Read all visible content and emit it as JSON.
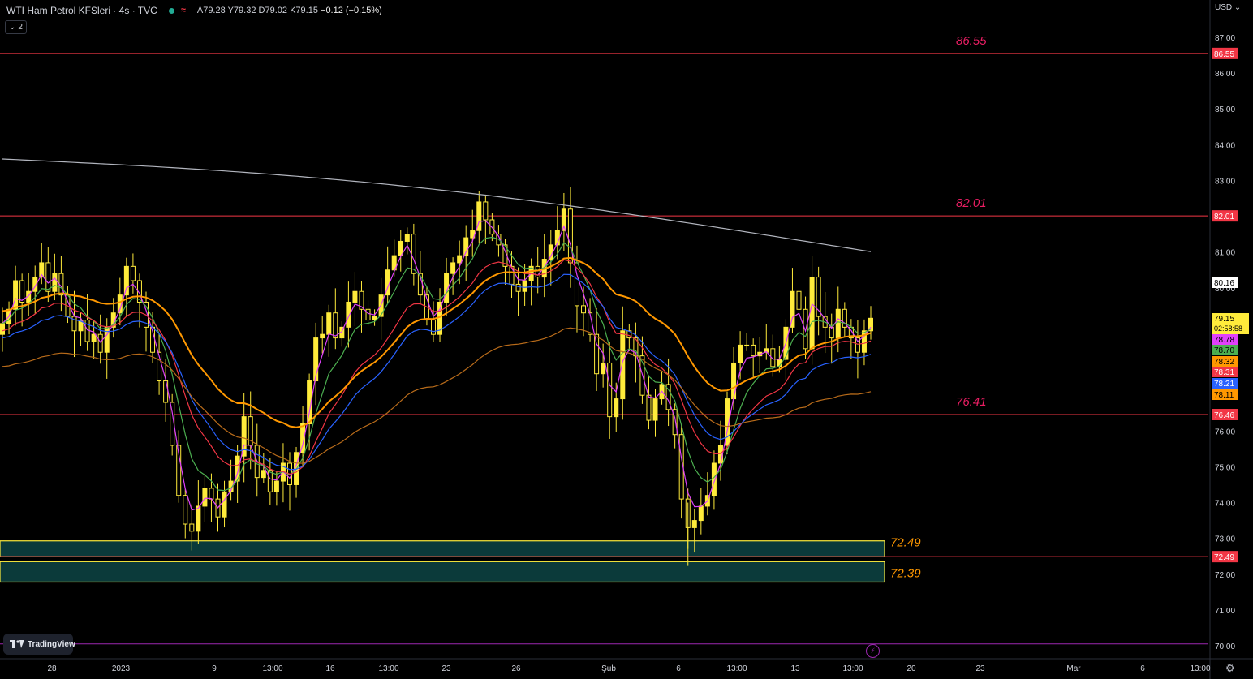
{
  "header": {
    "title": "WTI Ham Petrol KFSleri · 4s · TVC",
    "status_icon": "market-open-dot",
    "o": "A79.28",
    "h": "Y79.32",
    "l": "D79.02",
    "c": "K79.15",
    "change": "−0.12 (−0.15%)",
    "collapse_count": "2"
  },
  "currency_label": "USD",
  "tradingview_label": "TradingView",
  "colors": {
    "background": "#000000",
    "candle": "#ffeb3b",
    "level_line": "#f23645",
    "level_label": "#e91e63",
    "zone_fill": "#0b3a3a",
    "zone_border": "#ffeb3b",
    "zone_label": "#ff9800",
    "purple_line": "#9c27b0",
    "ema_magenta": "#e040fb",
    "ema_green": "#4caf50",
    "ema_red": "#f23645",
    "ema_blue": "#2962ff",
    "ema_orange": "#ff9800",
    "ema_darkorange": "#b86b1a",
    "ema_white": "#b2b5be"
  },
  "chart_data": {
    "type": "candlestick",
    "title": "WTI Ham Petrol KFSleri · 4s · TVC",
    "y_range": [
      69.5,
      87.7
    ],
    "y_ticks": [
      "87.00",
      "86.00",
      "85.00",
      "84.00",
      "83.00",
      "82.00",
      "81.00",
      "80.00",
      "79.00",
      "78.00",
      "77.00",
      "76.00",
      "75.00",
      "74.00",
      "73.00",
      "72.00",
      "71.00",
      "70.00"
    ],
    "x_ticks": [
      "28",
      "2023",
      "9",
      "13:00",
      "16",
      "13:00",
      "23",
      "26",
      "Şub",
      "6",
      "13:00",
      "13",
      "13:00",
      "20",
      "23",
      "Mar",
      "6",
      "13:00"
    ],
    "levels": [
      {
        "value": 86.55,
        "label": "86.55",
        "axis_label": "86.55",
        "color": "#f23645"
      },
      {
        "value": 82.01,
        "label": "82.01",
        "axis_label": "82.01",
        "color": "#f23645"
      },
      {
        "value": 76.46,
        "label": "76.41",
        "axis_label": "76.46",
        "color": "#f23645"
      },
      {
        "value": 72.49,
        "axis_label": "72.49",
        "color": "#f23645"
      },
      {
        "value": 70.05,
        "color": "#9c27b0"
      }
    ],
    "zones": [
      {
        "from": 72.49,
        "to": 72.93,
        "label": "72.49"
      },
      {
        "from": 71.78,
        "to": 72.35,
        "label": "72.39"
      }
    ],
    "price_badges": [
      {
        "value": "80.16",
        "bg": "#ffffff",
        "fg": "#000000"
      },
      {
        "value": "79.15",
        "sub": "02:58:58",
        "bg": "#ffeb3b",
        "fg": "#000000"
      },
      {
        "value": "78.78",
        "bg": "#e040fb",
        "fg": "#000000"
      },
      {
        "value": "78.70",
        "bg": "#4caf50",
        "fg": "#000000"
      },
      {
        "value": "78.32",
        "bg": "#ff9800",
        "fg": "#000000"
      },
      {
        "value": "78.31",
        "bg": "#f23645",
        "fg": "#ffffff"
      },
      {
        "value": "78.21",
        "bg": "#2962ff",
        "fg": "#ffffff"
      },
      {
        "value": "78.11",
        "bg": "#ff9800",
        "fg": "#000000"
      }
    ],
    "closes": [
      79.0,
      79.4,
      80.2,
      79.6,
      79.9,
      80.3,
      80.7,
      79.9,
      80.4,
      79.8,
      79.2,
      78.8,
      79.1,
      78.5,
      78.7,
      78.2,
      78.9,
      79.3,
      79.8,
      80.6,
      80.2,
      79.6,
      78.9,
      78.2,
      77.4,
      76.8,
      75.6,
      74.2,
      73.4,
      73.2,
      73.9,
      74.4,
      74.1,
      73.6,
      74.3,
      74.6,
      75.3,
      76.4,
      75.6,
      74.7,
      74.9,
      74.3,
      74.6,
      75.1,
      74.5,
      75.4,
      76.2,
      77.4,
      78.6,
      78.7,
      79.3,
      78.6,
      78.9,
      79.6,
      79.9,
      79.4,
      79.1,
      79.2,
      79.8,
      80.5,
      80.9,
      81.3,
      81.5,
      80.4,
      79.8,
      79.1,
      78.7,
      79.6,
      80.4,
      80.7,
      80.9,
      81.4,
      81.6,
      82.4,
      81.9,
      81.5,
      81.2,
      80.6,
      80.1,
      79.9,
      80.2,
      80.6,
      80.3,
      80.8,
      81.2,
      81.6,
      82.2,
      80.7,
      79.5,
      79.3,
      78.7,
      77.6,
      77.9,
      76.4,
      76.9,
      78.8,
      78.6,
      78.1,
      77.0,
      76.3,
      76.9,
      77.3,
      76.6,
      75.9,
      74.1,
      73.3,
      73.5,
      73.9,
      74.2,
      75.1,
      75.6,
      76.9,
      77.9,
      78.4,
      78.4,
      78.1,
      78.2,
      78.3,
      77.8,
      78.0,
      78.9,
      79.9,
      79.4,
      78.3,
      80.3,
      79.2,
      78.9,
      78.6,
      79.4,
      78.9,
      78.6,
      78.2,
      78.8,
      79.15
    ],
    "highs_last": 80.6,
    "lows_min": 72.23
  }
}
